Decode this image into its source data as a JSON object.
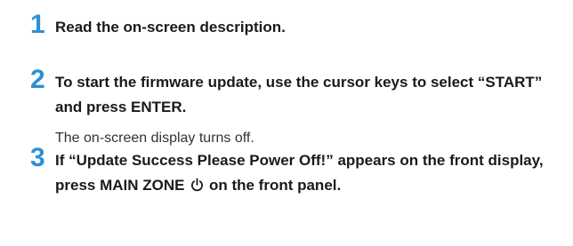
{
  "colors": {
    "step_number": "#2e8fd6",
    "text": "#1a1a1a"
  },
  "steps": [
    {
      "number": "1",
      "text": "Read the on-screen description."
    },
    {
      "number": "2",
      "text": "To start the firmware update, use the cursor keys to select “START” and press ENTER.",
      "note": "The on-screen display turns off."
    },
    {
      "number": "3",
      "text_before_icon": "If “Update Success Please Power Off!” appears on the front display, press MAIN ZONE",
      "icon": "power-icon",
      "text_after_icon": "on the front panel."
    }
  ]
}
